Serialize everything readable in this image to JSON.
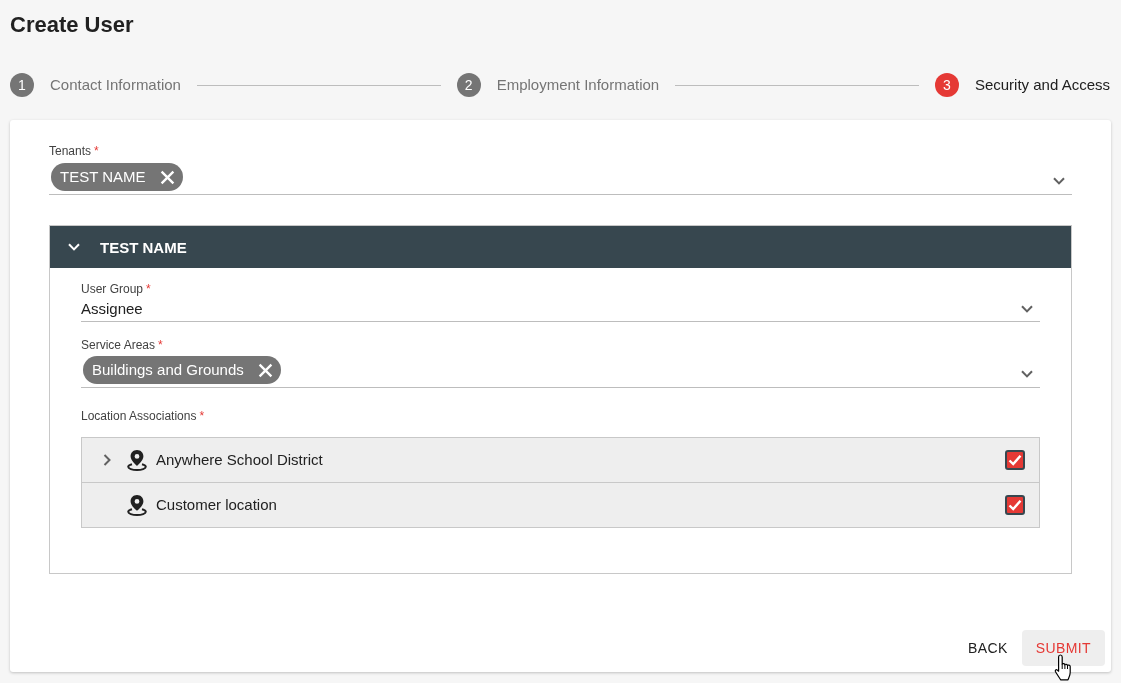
{
  "page": {
    "title": "Create User"
  },
  "stepper": {
    "steps": [
      {
        "number": "1",
        "label": "Contact Information",
        "selected": false
      },
      {
        "number": "2",
        "label": "Employment Information",
        "selected": false
      },
      {
        "number": "3",
        "label": "Security and Access",
        "selected": true
      }
    ]
  },
  "form": {
    "tenants": {
      "label": "Tenants",
      "required_mark": "*",
      "chips": [
        {
          "label": "TEST NAME"
        }
      ]
    },
    "tenant_panels": [
      {
        "title": "TEST NAME",
        "expanded": true,
        "user_group": {
          "label": "User Group",
          "required_mark": "*",
          "value": "Assignee"
        },
        "service_areas": {
          "label": "Service Areas",
          "required_mark": "*",
          "chips": [
            {
              "label": "Buildings and Grounds"
            }
          ]
        },
        "location_associations": {
          "label": "Location Associations",
          "required_mark": "*",
          "items": [
            {
              "label": "Anywhere School District",
              "kind": "expandable",
              "expanded": false,
              "checked": true
            },
            {
              "label": "Customer location",
              "kind": "leaf",
              "checked": true
            }
          ]
        }
      }
    ]
  },
  "buttons": [
    {
      "label": "BACK",
      "kind": "secondary",
      "hovered": false
    },
    {
      "label": "SUBMIT",
      "kind": "primary",
      "hovered": true
    }
  ]
}
